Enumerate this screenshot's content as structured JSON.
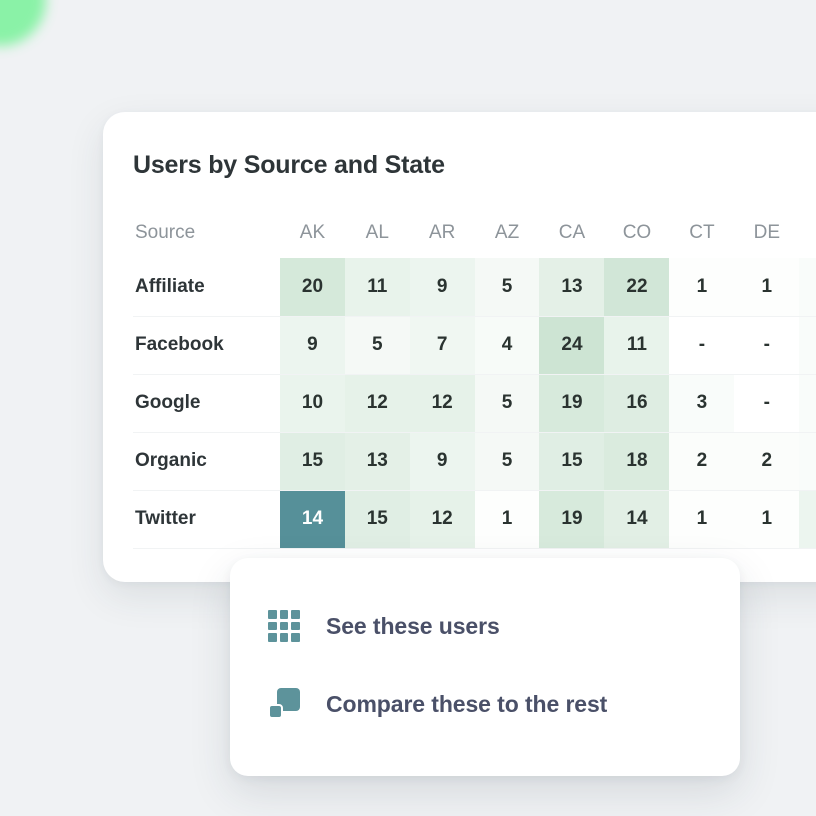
{
  "page": {
    "background_color": "#f0f2f4",
    "accent_color": "#79f29a"
  },
  "card": {
    "title": "Users by Source and State",
    "selected_cell_color": "#569099",
    "heat_color": "#7ebb8e"
  },
  "chart_data": {
    "type": "heatmap",
    "title": "Users by Source and State",
    "xlabel": "",
    "ylabel": "Source",
    "row_header_label": "Source",
    "categories": [
      "AK",
      "AL",
      "AR",
      "AZ",
      "CA",
      "CO",
      "CT",
      "DE"
    ],
    "rows": [
      "Affiliate",
      "Facebook",
      "Google",
      "Organic",
      "Twitter"
    ],
    "values": [
      [
        20,
        11,
        9,
        5,
        13,
        22,
        1,
        1
      ],
      [
        9,
        5,
        7,
        4,
        24,
        11,
        null,
        null
      ],
      [
        10,
        12,
        12,
        5,
        19,
        16,
        3,
        null
      ],
      [
        15,
        13,
        9,
        5,
        15,
        18,
        2,
        2
      ],
      [
        14,
        15,
        12,
        1,
        19,
        14,
        1,
        1
      ]
    ],
    "display": [
      [
        "20",
        "11",
        "9",
        "5",
        "13",
        "22",
        "1",
        "1"
      ],
      [
        "9",
        "5",
        "7",
        "4",
        "24",
        "11",
        "-",
        "-"
      ],
      [
        "10",
        "12",
        "12",
        "5",
        "19",
        "16",
        "3",
        "-"
      ],
      [
        "15",
        "13",
        "9",
        "5",
        "15",
        "18",
        "2",
        "2"
      ],
      [
        "14",
        "15",
        "12",
        "1",
        "19",
        "14",
        "1",
        "1"
      ]
    ],
    "selected": {
      "row": "Twitter",
      "column": "AK",
      "value": 14
    },
    "vmin": 0,
    "vmax": 24,
    "grid": false,
    "legend": "none",
    "null_placeholder": "-"
  },
  "context_menu": {
    "items": [
      {
        "label": "See these users",
        "icon": "grid-icon"
      },
      {
        "label": "Compare these to the rest",
        "icon": "compare-squares-icon"
      }
    ]
  }
}
